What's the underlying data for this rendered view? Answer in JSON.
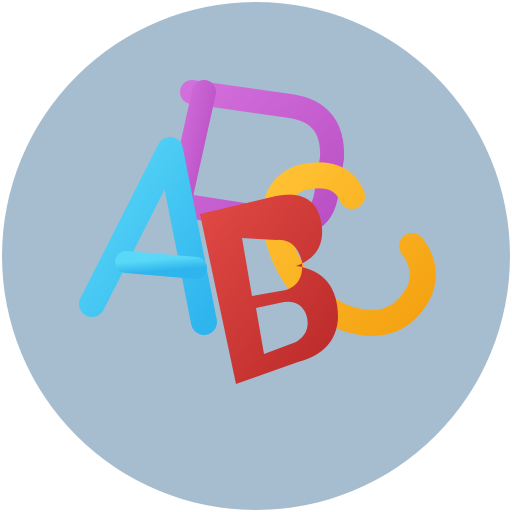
{
  "icon": {
    "name": "abc-letters-icon",
    "background_color": "#a6bdd0",
    "letters": [
      {
        "glyph": "A",
        "color": "#46c9f0"
      },
      {
        "glyph": "B",
        "color": "#d83a3a"
      },
      {
        "glyph": "C",
        "color": "#f8b21c"
      },
      {
        "glyph": "D",
        "color": "#c85fcf"
      }
    ]
  }
}
